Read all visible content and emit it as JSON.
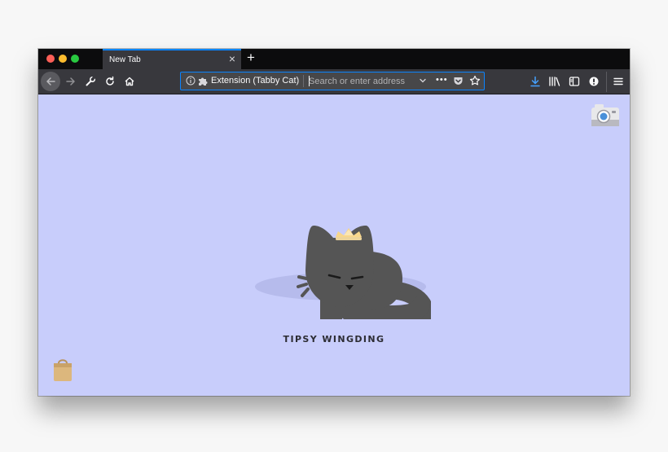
{
  "browser": {
    "tab": {
      "title": "New Tab",
      "close_glyph": "×"
    },
    "new_tab_glyph": "+",
    "urlbar": {
      "identity_label": "Extension (Tabby Cat)",
      "placeholder": "Search or enter address",
      "more_glyph": "•••"
    },
    "accent_color": "#0a84ff"
  },
  "content": {
    "background_color": "#c8cdfb",
    "cat_name": "TIPSY WINGDING",
    "cat_color": "#555555",
    "accessory": "crown"
  },
  "icons": [
    "back-arrow-icon",
    "forward-arrow-icon",
    "wrench-icon",
    "reload-icon",
    "home-icon",
    "info-icon",
    "puzzle-icon",
    "chevron-down-icon",
    "more-icon",
    "pocket-icon",
    "star-icon",
    "download-icon",
    "library-icon",
    "sidebar-icon",
    "extension-icon",
    "hamburger-menu-icon",
    "camera-icon",
    "shopping-bag-icon"
  ]
}
